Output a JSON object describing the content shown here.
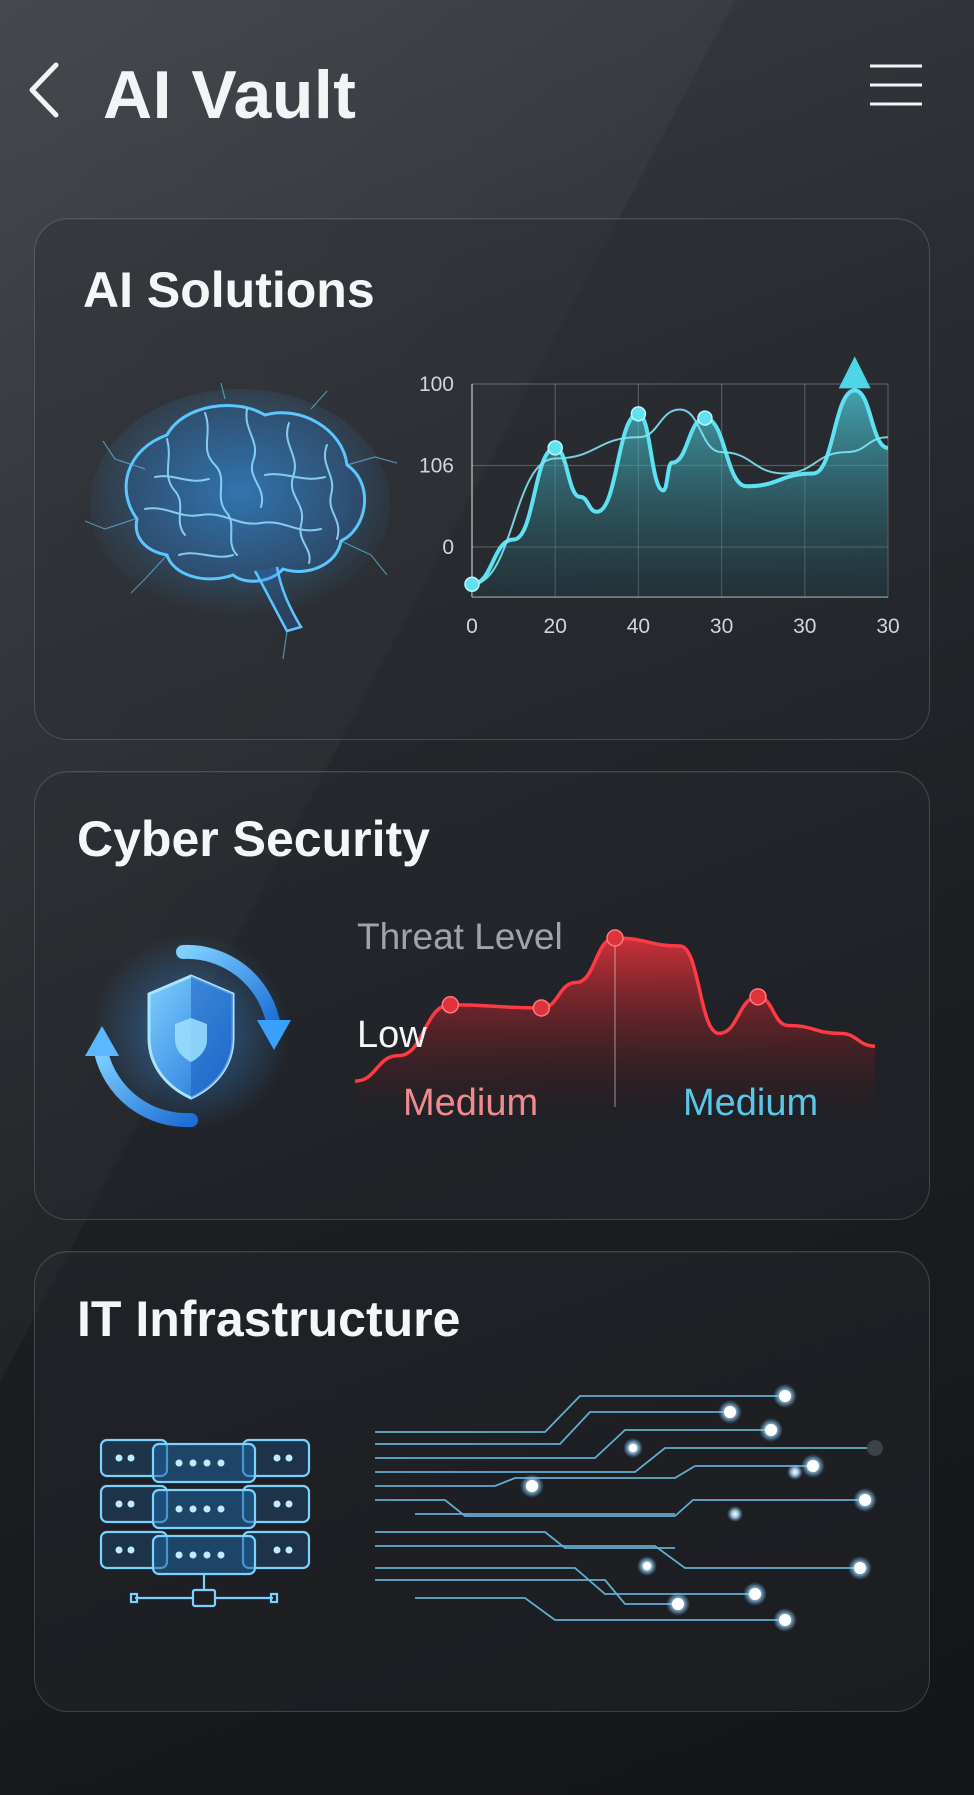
{
  "header": {
    "title": "AI Vault",
    "back_icon": "chevron-left-icon",
    "menu_icon": "hamburger-menu-icon"
  },
  "cards": {
    "ai": {
      "title": "AI Solutions",
      "icon": "brain-icon",
      "accent": "#4fd6e6"
    },
    "cyber": {
      "title": "Cyber Security",
      "icon": "shield-sync-icon",
      "threat_title": "Threat Level",
      "level_low": "Low",
      "level_left": "Medium",
      "level_right": "Medium",
      "accent_red": "#e0323a",
      "accent_blue": "#58c8e8"
    },
    "infra": {
      "title": "IT Infrastructure",
      "icon": "server-stack-icon",
      "decoration": "circuit-traces-icon"
    }
  },
  "chart_data": [
    {
      "type": "area",
      "title": "",
      "xlabel": "",
      "ylabel": "",
      "x_tick_labels": [
        "0",
        "20",
        "40",
        "30",
        "30",
        "30"
      ],
      "y_tick_labels": [
        "100",
        "106",
        "0"
      ],
      "series": [
        {
          "values": [
            [
              0,
              6
            ],
            [
              10,
              27
            ],
            [
              20,
              70
            ],
            [
              26,
              47
            ],
            [
              30,
              40
            ],
            [
              40,
              86
            ],
            [
              46,
              50
            ],
            [
              48,
              63
            ],
            [
              56,
              84
            ],
            [
              66,
              52
            ],
            [
              82,
              58
            ],
            [
              92,
              97
            ],
            [
              100,
              70
            ]
          ]
        }
      ],
      "trend_line": [
        [
          0,
          6
        ],
        [
          20,
          65
        ],
        [
          40,
          75
        ],
        [
          50,
          88
        ],
        [
          60,
          68
        ],
        [
          75,
          58
        ],
        [
          90,
          68
        ],
        [
          100,
          75
        ]
      ],
      "markers": [
        [
          0,
          6
        ],
        [
          20,
          70
        ],
        [
          40,
          86
        ],
        [
          56,
          84
        ]
      ],
      "xlim": [
        0,
        100
      ],
      "ylim": [
        0,
        100
      ],
      "grid": true
    },
    {
      "type": "area",
      "title": "Threat Level",
      "series": [
        {
          "values": [
            [
              0,
              10
            ],
            [
              10,
              26
            ],
            [
              22,
              58
            ],
            [
              43,
              56
            ],
            [
              51,
              72
            ],
            [
              60,
              100
            ],
            [
              75,
              95
            ],
            [
              84,
              40
            ],
            [
              93,
              63
            ],
            [
              100,
              45
            ],
            [
              112,
              40
            ],
            [
              120,
              32
            ]
          ]
        }
      ],
      "markers": [
        [
          22,
          58
        ],
        [
          43,
          56
        ],
        [
          60,
          100
        ],
        [
          93,
          63
        ]
      ],
      "xlim": [
        0,
        120
      ],
      "ylim": [
        0,
        100
      ],
      "grid": false
    }
  ]
}
